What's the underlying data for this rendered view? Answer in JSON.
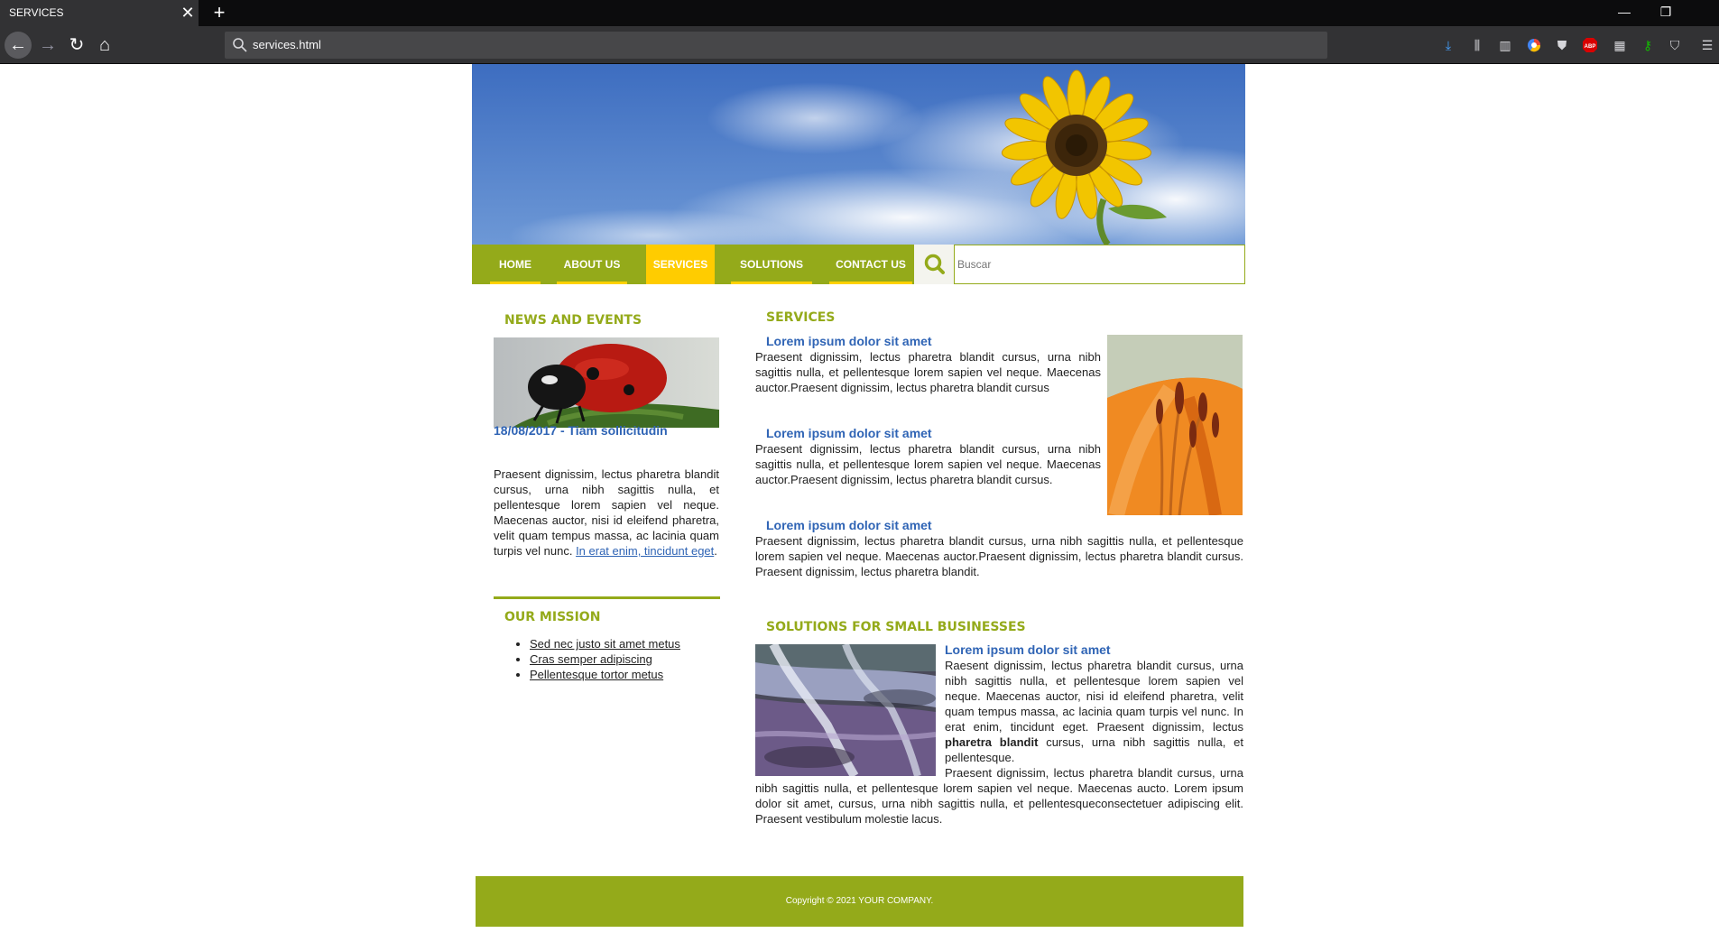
{
  "browser": {
    "tab_title": "SERVICES",
    "url": "services.html"
  },
  "nav": {
    "items": [
      {
        "label": "HOME",
        "active": false
      },
      {
        "label": "ABOUT US",
        "active": false
      },
      {
        "label": "SERVICES",
        "active": true
      },
      {
        "label": "SOLUTIONS",
        "active": false
      },
      {
        "label": "CONTACT US",
        "active": false
      }
    ],
    "search_placeholder": "Buscar"
  },
  "sidebar": {
    "news_heading": "NEWS AND EVENTS",
    "news_title": "18/08/2017 - Tiam sollicitudin",
    "news_text": "Praesent dignissim, lectus pharetra blandit cursus, urna nibh sagittis nulla, et pellentesque lorem sapien vel neque. Maecenas auctor, nisi id eleifend pharetra, velit quam tempus massa, ac lacinia quam turpis vel nunc.",
    "news_link": "In erat enim, tincidunt eget",
    "mission_heading": "OUR MISSION",
    "mission_items": [
      "Sed nec justo sit amet metus",
      "Cras semper adipiscing",
      "Pellentesque tortor metus"
    ]
  },
  "main": {
    "services_heading": "SERVICES",
    "services": [
      {
        "title": "Lorem ipsum dolor sit amet",
        "text": "Praesent dignissim, lectus pharetra blandit cursus, urna nibh sagittis nulla, et pellentesque lorem sapien vel neque. Maecenas auctor.Praesent dignissim, lectus pharetra blandit cursus"
      },
      {
        "title": "Lorem ipsum dolor sit amet",
        "text": "Praesent dignissim, lectus pharetra blandit cursus, urna nibh sagittis nulla, et pellentesque lorem sapien vel neque. Maecenas auctor.Praesent dignissim, lectus pharetra blandit cursus."
      },
      {
        "title": "Lorem ipsum dolor sit amet",
        "text": "Praesent dignissim, lectus pharetra blandit cursus, urna nibh sagittis nulla, et pellentesque lorem sapien vel neque. Maecenas auctor.Praesent dignissim, lectus pharetra blandit cursus. Praesent dignissim, lectus pharetra blandit."
      }
    ],
    "solutions_heading": "SOLUTIONS FOR SMALL BUSINESSES",
    "solutions_title": "Lorem ipsum dolor sit amet",
    "solutions_text_1": "Raesent dignissim, lectus pharetra blandit cursus, urna nibh sagittis nulla, et pellentesque lorem sapien vel neque. Maecenas auctor, nisi id eleifend pharetra, velit quam tempus massa, ac lacinia quam turpis vel nunc. In erat enim, tincidunt eget. Praesent dignissim, lectus ",
    "solutions_bold": "pharetra blandit",
    "solutions_text_2": " cursus, urna nibh sagittis nulla, et pellentesque.",
    "solutions_text_3": "Praesent dignissim, lectus pharetra blandit cursus, urna nibh sagittis nulla, et pellentesque lorem sapien vel neque. Maecenas aucto. Lorem ipsum dolor sit amet, cursus, urna nibh sagittis nulla, et pellentesqueconsectetuer adipiscing elit. Praesent vestibulum molestie lacus."
  },
  "footer": {
    "copyright": "Copyright © 2021 YOUR COMPANY."
  },
  "colors": {
    "accent_green": "#94aa1a",
    "active_yellow": "#ffcc00",
    "title_blue": "#2f64b5"
  },
  "icons": [
    "close-icon",
    "plus-icon",
    "minimize-icon",
    "restore-icon",
    "back-arrow-icon",
    "forward-arrow-icon",
    "reload-icon",
    "home-icon",
    "search-icon",
    "download-icon",
    "library-icon",
    "sidebar-icon",
    "extension-icon",
    "shield-icon",
    "adblock-icon",
    "key-icon",
    "menu-icon"
  ]
}
